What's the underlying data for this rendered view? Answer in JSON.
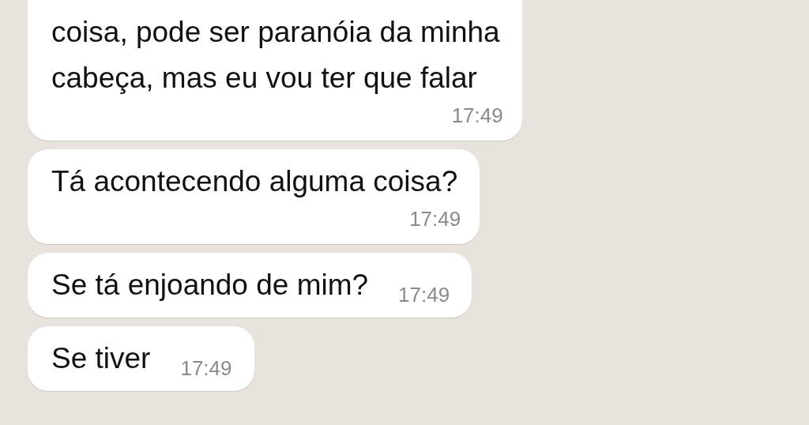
{
  "messages": [
    {
      "kind": "stacked",
      "lines": [
        "coisa, pode ser paranóia da minha",
        "cabeça, mas eu vou ter que falar"
      ],
      "time": "17:49"
    },
    {
      "kind": "stacked",
      "lines": [
        "Tá acontecendo alguma coisa?"
      ],
      "time": "17:49"
    },
    {
      "kind": "inline",
      "lines": [
        "Se tá enjoando de mim?"
      ],
      "time": "17:49"
    },
    {
      "kind": "inline",
      "lines": [
        "Se tiver"
      ],
      "time": "17:49"
    }
  ]
}
